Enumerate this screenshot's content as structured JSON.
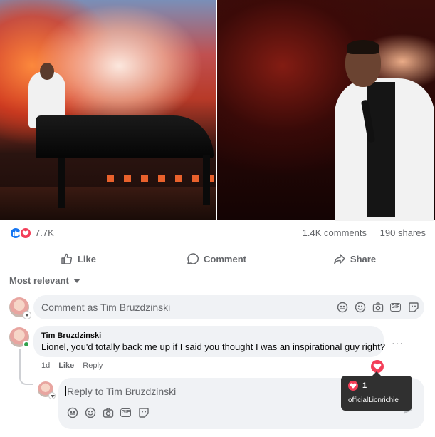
{
  "post": {
    "reaction_count": "7.7K",
    "comments_count": "1.4K comments",
    "shares_count": "190 shares"
  },
  "actions": {
    "like_label": "Like",
    "comment_label": "Comment",
    "share_label": "Share"
  },
  "sort": {
    "label": "Most relevant"
  },
  "comment_input": {
    "placeholder": "Comment as Tim Bruzdzinski"
  },
  "comment": {
    "author": "Tim Bruzdzinski",
    "text": "Lionel, you'd totally back me up if I said you thought I was an inspirational guy right?",
    "time": "1d",
    "like_label": "Like",
    "reply_label": "Reply",
    "more": "···"
  },
  "reply_input": {
    "placeholder": "Reply to Tim Bruzdzinski"
  },
  "reaction_tooltip": {
    "count": "1",
    "user": "officialLionrichie"
  },
  "tools": {
    "gif_label": "GIF"
  },
  "colors": {
    "like_blue": "#1877f2",
    "love_red": "#f33e58",
    "bubble_bg": "#f0f2f5",
    "muted_text": "#65676b"
  }
}
